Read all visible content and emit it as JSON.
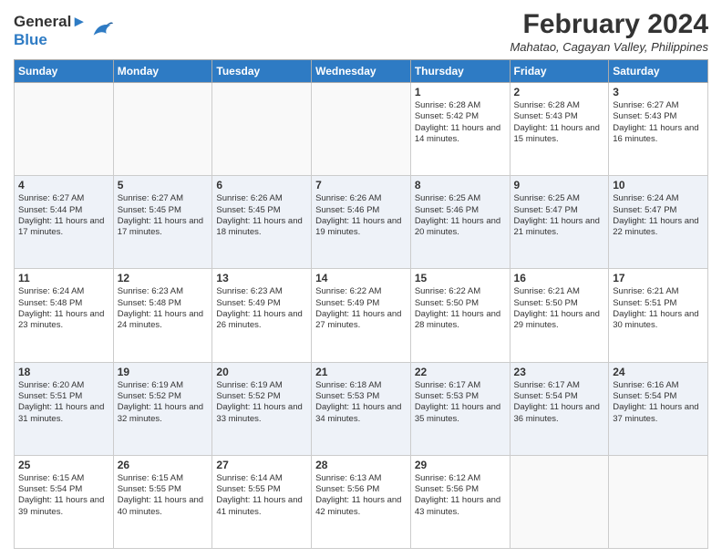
{
  "header": {
    "logo_line1": "General",
    "logo_line2": "Blue",
    "month_year": "February 2024",
    "location": "Mahatao, Cagayan Valley, Philippines"
  },
  "days_of_week": [
    "Sunday",
    "Monday",
    "Tuesday",
    "Wednesday",
    "Thursday",
    "Friday",
    "Saturday"
  ],
  "weeks": [
    [
      {
        "day": "",
        "info": ""
      },
      {
        "day": "",
        "info": ""
      },
      {
        "day": "",
        "info": ""
      },
      {
        "day": "",
        "info": ""
      },
      {
        "day": "1",
        "info": "Sunrise: 6:28 AM\nSunset: 5:42 PM\nDaylight: 11 hours and 14 minutes."
      },
      {
        "day": "2",
        "info": "Sunrise: 6:28 AM\nSunset: 5:43 PM\nDaylight: 11 hours and 15 minutes."
      },
      {
        "day": "3",
        "info": "Sunrise: 6:27 AM\nSunset: 5:43 PM\nDaylight: 11 hours and 16 minutes."
      }
    ],
    [
      {
        "day": "4",
        "info": "Sunrise: 6:27 AM\nSunset: 5:44 PM\nDaylight: 11 hours and 17 minutes."
      },
      {
        "day": "5",
        "info": "Sunrise: 6:27 AM\nSunset: 5:45 PM\nDaylight: 11 hours and 17 minutes."
      },
      {
        "day": "6",
        "info": "Sunrise: 6:26 AM\nSunset: 5:45 PM\nDaylight: 11 hours and 18 minutes."
      },
      {
        "day": "7",
        "info": "Sunrise: 6:26 AM\nSunset: 5:46 PM\nDaylight: 11 hours and 19 minutes."
      },
      {
        "day": "8",
        "info": "Sunrise: 6:25 AM\nSunset: 5:46 PM\nDaylight: 11 hours and 20 minutes."
      },
      {
        "day": "9",
        "info": "Sunrise: 6:25 AM\nSunset: 5:47 PM\nDaylight: 11 hours and 21 minutes."
      },
      {
        "day": "10",
        "info": "Sunrise: 6:24 AM\nSunset: 5:47 PM\nDaylight: 11 hours and 22 minutes."
      }
    ],
    [
      {
        "day": "11",
        "info": "Sunrise: 6:24 AM\nSunset: 5:48 PM\nDaylight: 11 hours and 23 minutes."
      },
      {
        "day": "12",
        "info": "Sunrise: 6:23 AM\nSunset: 5:48 PM\nDaylight: 11 hours and 24 minutes."
      },
      {
        "day": "13",
        "info": "Sunrise: 6:23 AM\nSunset: 5:49 PM\nDaylight: 11 hours and 26 minutes."
      },
      {
        "day": "14",
        "info": "Sunrise: 6:22 AM\nSunset: 5:49 PM\nDaylight: 11 hours and 27 minutes."
      },
      {
        "day": "15",
        "info": "Sunrise: 6:22 AM\nSunset: 5:50 PM\nDaylight: 11 hours and 28 minutes."
      },
      {
        "day": "16",
        "info": "Sunrise: 6:21 AM\nSunset: 5:50 PM\nDaylight: 11 hours and 29 minutes."
      },
      {
        "day": "17",
        "info": "Sunrise: 6:21 AM\nSunset: 5:51 PM\nDaylight: 11 hours and 30 minutes."
      }
    ],
    [
      {
        "day": "18",
        "info": "Sunrise: 6:20 AM\nSunset: 5:51 PM\nDaylight: 11 hours and 31 minutes."
      },
      {
        "day": "19",
        "info": "Sunrise: 6:19 AM\nSunset: 5:52 PM\nDaylight: 11 hours and 32 minutes."
      },
      {
        "day": "20",
        "info": "Sunrise: 6:19 AM\nSunset: 5:52 PM\nDaylight: 11 hours and 33 minutes."
      },
      {
        "day": "21",
        "info": "Sunrise: 6:18 AM\nSunset: 5:53 PM\nDaylight: 11 hours and 34 minutes."
      },
      {
        "day": "22",
        "info": "Sunrise: 6:17 AM\nSunset: 5:53 PM\nDaylight: 11 hours and 35 minutes."
      },
      {
        "day": "23",
        "info": "Sunrise: 6:17 AM\nSunset: 5:54 PM\nDaylight: 11 hours and 36 minutes."
      },
      {
        "day": "24",
        "info": "Sunrise: 6:16 AM\nSunset: 5:54 PM\nDaylight: 11 hours and 37 minutes."
      }
    ],
    [
      {
        "day": "25",
        "info": "Sunrise: 6:15 AM\nSunset: 5:54 PM\nDaylight: 11 hours and 39 minutes."
      },
      {
        "day": "26",
        "info": "Sunrise: 6:15 AM\nSunset: 5:55 PM\nDaylight: 11 hours and 40 minutes."
      },
      {
        "day": "27",
        "info": "Sunrise: 6:14 AM\nSunset: 5:55 PM\nDaylight: 11 hours and 41 minutes."
      },
      {
        "day": "28",
        "info": "Sunrise: 6:13 AM\nSunset: 5:56 PM\nDaylight: 11 hours and 42 minutes."
      },
      {
        "day": "29",
        "info": "Sunrise: 6:12 AM\nSunset: 5:56 PM\nDaylight: 11 hours and 43 minutes."
      },
      {
        "day": "",
        "info": ""
      },
      {
        "day": "",
        "info": ""
      }
    ]
  ]
}
